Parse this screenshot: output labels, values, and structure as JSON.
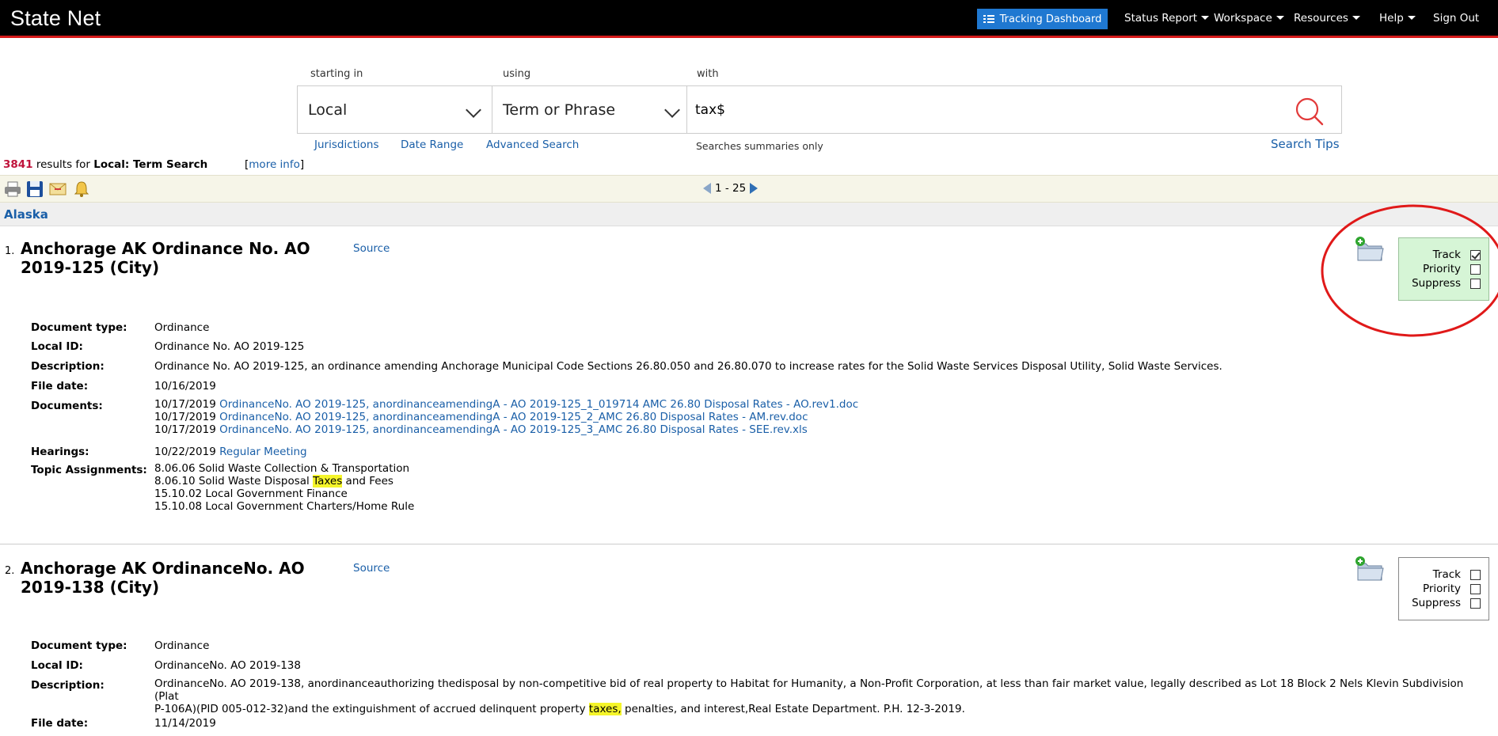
{
  "header": {
    "brand": "State Net",
    "nav": {
      "tracking_dashboard": "Tracking Dashboard",
      "status_report": "Status Report",
      "workspace": "Workspace",
      "resources": "Resources",
      "help": "Help",
      "sign_out": "Sign Out"
    }
  },
  "search": {
    "starting_in_label": "starting in",
    "using_label": "using",
    "with_label": "with",
    "starting_in_value": "Local",
    "using_value": "Term or Phrase",
    "query_value": "tax$",
    "links": {
      "jurisdictions": "Jurisdictions",
      "date_range": "Date Range",
      "advanced_search": "Advanced Search",
      "search_tips": "Search Tips"
    },
    "note": "Searches summaries only"
  },
  "results": {
    "count": "3841",
    "results_for": "results for",
    "query_desc": "Local: Term Search",
    "more_info": "more info",
    "more_info_open": "[",
    "more_info_close": "]",
    "pager": {
      "range": "1 - 25"
    },
    "group": "Alaska",
    "track_labels": {
      "track": "Track",
      "priority": "Priority",
      "suppress": "Suppress"
    },
    "field_labels": {
      "doc_type": "Document type:",
      "local_id": "Local ID:",
      "description": "Description:",
      "file_date": "File date:",
      "documents": "Documents:",
      "hearings": "Hearings:",
      "topics": "Topic Assignments:"
    },
    "items": [
      {
        "num": "1.",
        "title": "Anchorage AK Ordinance No. AO 2019-125 (City)",
        "source": "Source",
        "tracked": true,
        "priority": false,
        "suppress": false,
        "doc_type": "Ordinance",
        "local_id": "Ordinance No. AO 2019-125",
        "description": "Ordinance No. AO 2019-125, an ordinance amending Anchorage Municipal Code Sections 26.80.050 and 26.80.070 to increase rates for the Solid Waste Services Disposal Utility, Solid Waste Services.",
        "file_date": "10/16/2019",
        "documents": [
          {
            "date": "10/17/2019",
            "link": "OrdinanceNo. AO 2019-125, anordinanceamendingA - AO 2019-125_1_019714 AMC 26.80 Disposal Rates - AO.rev1.doc"
          },
          {
            "date": "10/17/2019",
            "link": "OrdinanceNo. AO 2019-125, anordinanceamendingA - AO 2019-125_2_AMC 26.80 Disposal Rates - AM.rev.doc"
          },
          {
            "date": "10/17/2019",
            "link": "OrdinanceNo. AO 2019-125, anordinanceamendingA - AO 2019-125_3_AMC 26.80 Disposal Rates - SEE.rev.xls"
          }
        ],
        "hearing": {
          "date": "10/22/2019",
          "link": "Regular Meeting"
        },
        "topics": {
          "t1": "8.06.06 Solid Waste Collection & Transportation",
          "t2_pre": "8.06.10 Solid Waste Disposal ",
          "t2_hl": "Taxes",
          "t2_post": " and Fees",
          "t3": "15.10.02 Local Government Finance",
          "t4": "15.10.08 Local Government Charters/Home Rule"
        }
      },
      {
        "num": "2.",
        "title": "Anchorage AK OrdinanceNo. AO 2019-138 (City)",
        "source": "Source",
        "tracked": false,
        "priority": false,
        "suppress": false,
        "doc_type": "Ordinance",
        "local_id": "OrdinanceNo. AO 2019-138",
        "description_l1": "OrdinanceNo. AO 2019-138, anordinanceauthorizing thedisposal by non-competitive bid of real property to Habitat for Humanity, a Non-Profit Corporation, at less than fair market value, legally described as Lot 18 Block 2 Nels Klevin Subdivision (Plat",
        "description_l2_pre": "P-106A)(PID 005-012-32)and the extinguishment of accrued delinquent property ",
        "description_hl": "taxes,",
        "description_l2_post": " penalties, and interest,Real Estate Department. P.H. 12-3-2019.",
        "file_date": "11/14/2019"
      }
    ]
  },
  "colors": {
    "topbar": "#000000",
    "accent_red": "#d41a1a",
    "dashboard_blue": "#1f78d1",
    "link_blue": "#1a5fa8",
    "count_red": "#c0143c",
    "highlight": "#f5f52a",
    "tracked_bg": "#d6f5d6"
  },
  "icons": [
    "list-icon",
    "caret-down-icon",
    "chevron-down-icon",
    "search-icon",
    "print-icon",
    "save-icon",
    "email-icon",
    "alert-bell-icon",
    "prev-page-icon",
    "next-page-icon",
    "add-folder-icon",
    "checkbox-icon"
  ]
}
